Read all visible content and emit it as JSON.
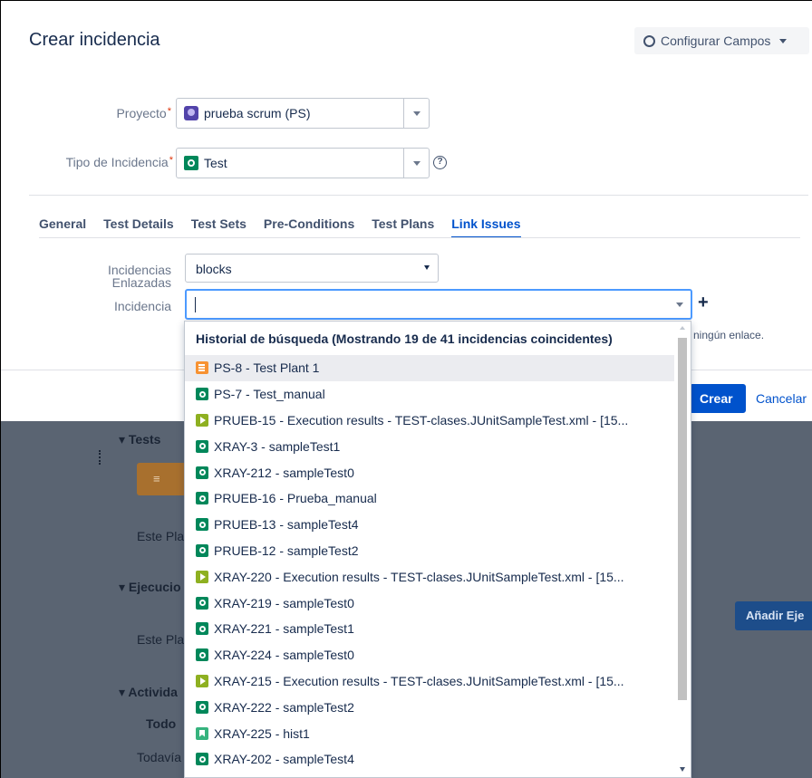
{
  "modal": {
    "title": "Crear incidencia",
    "config_button": "Configurar Campos",
    "fields": {
      "project_label": "Proyecto",
      "project_value": "prueba scrum (PS)",
      "issue_type_label": "Tipo de Incidencia",
      "issue_type_value": "Test",
      "required_mark": "*"
    },
    "tabs": [
      {
        "label": "General"
      },
      {
        "label": "Test Details"
      },
      {
        "label": "Test Sets"
      },
      {
        "label": "Pre-Conditions"
      },
      {
        "label": "Test Plans"
      },
      {
        "label": "Link Issues",
        "active": true
      }
    ],
    "link": {
      "linked_label": "Incidencias Enlazadas",
      "linked_value": "blocks",
      "issue_label": "Incidencia",
      "issue_value": "",
      "no_link_text": "ningún enlace."
    },
    "footer": {
      "create": "Crear",
      "cancel": "Cancelar"
    }
  },
  "dropdown": {
    "header": "Historial de búsqueda (Mostrando 19 de 41 incidencias coincidentes)",
    "items": [
      {
        "type": "plan",
        "text": "PS-8 - Test Plant 1",
        "highlighted": true
      },
      {
        "type": "test",
        "text": "PS-7 - Test_manual"
      },
      {
        "type": "exec",
        "text": "PRUEB-15 - Execution results - TEST-clases.JUnitSampleTest.xml - [15..."
      },
      {
        "type": "test",
        "text": "XRAY-3 - sampleTest1"
      },
      {
        "type": "test",
        "text": "XRAY-212 - sampleTest0"
      },
      {
        "type": "test",
        "text": "PRUEB-16 - Prueba_manual"
      },
      {
        "type": "test",
        "text": "PRUEB-13 - sampleTest4"
      },
      {
        "type": "test",
        "text": "PRUEB-12 - sampleTest2"
      },
      {
        "type": "exec",
        "text": "XRAY-220 - Execution results - TEST-clases.JUnitSampleTest.xml - [15..."
      },
      {
        "type": "test",
        "text": "XRAY-219 - sampleTest0"
      },
      {
        "type": "test",
        "text": "XRAY-221 - sampleTest1"
      },
      {
        "type": "test",
        "text": "XRAY-224 - sampleTest0"
      },
      {
        "type": "exec",
        "text": "XRAY-215 - Execution results - TEST-clases.JUnitSampleTest.xml - [15..."
      },
      {
        "type": "test",
        "text": "XRAY-222 - sampleTest2"
      },
      {
        "type": "story",
        "text": "XRAY-225 - hist1"
      },
      {
        "type": "test",
        "text": "XRAY-202 - sampleTest4"
      }
    ]
  },
  "background": {
    "tests": "Tests",
    "este_pla_1": "Este Pla",
    "ejecucio": "Ejecucio",
    "este_pla_2": "Este Pla",
    "activida": "Activida",
    "todo": "Todo",
    "todavia": "Todavía",
    "anadir": "Añadir Eje"
  }
}
